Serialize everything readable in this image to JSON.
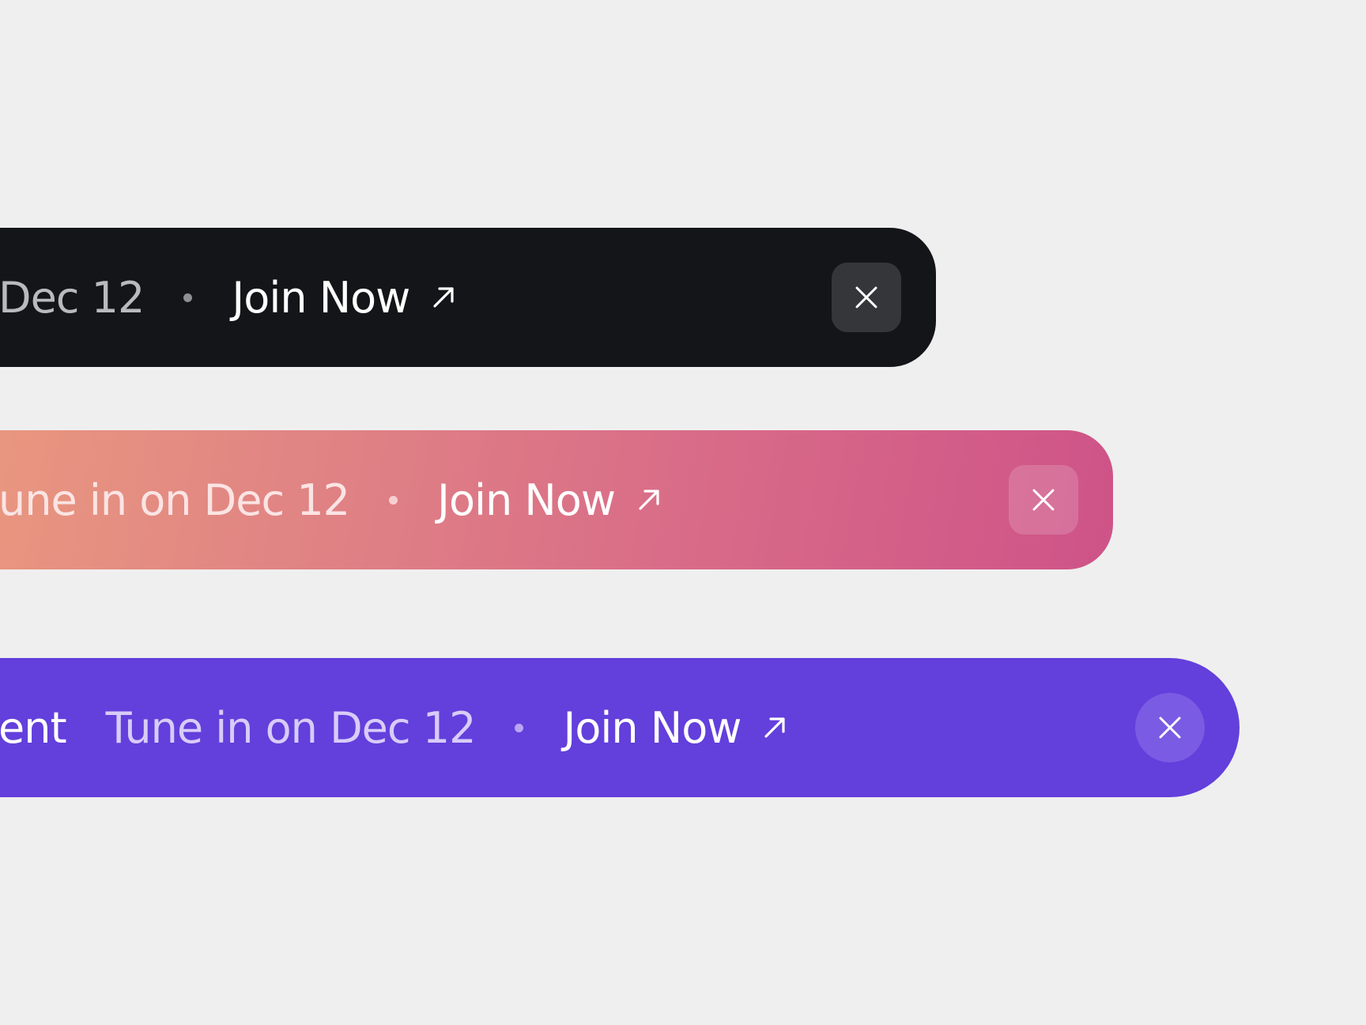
{
  "banners": [
    {
      "id": "dark",
      "event_text": "Dec 12",
      "separator": "•",
      "cta_label": "Join Now",
      "cta_icon": "arrow-up-right-icon",
      "close_icon": "close-icon",
      "colors": {
        "background": "#141518",
        "button": "#35363a"
      }
    },
    {
      "id": "gradient",
      "event_text": "une in on Dec 12",
      "separator": "•",
      "cta_label": "Join Now",
      "cta_icon": "arrow-up-right-icon",
      "close_icon": "close-icon",
      "colors": {
        "gradient_start": "#e9987f",
        "gradient_end": "#ce5388"
      }
    },
    {
      "id": "purple",
      "leading_text": "ent",
      "event_text": "Tune in on Dec 12",
      "separator": "•",
      "cta_label": "Join Now",
      "cta_icon": "arrow-up-right-icon",
      "close_icon": "close-icon",
      "colors": {
        "background": "#633fdc",
        "button": "#7a5be3"
      }
    }
  ],
  "page": {
    "background": "#efefef"
  }
}
